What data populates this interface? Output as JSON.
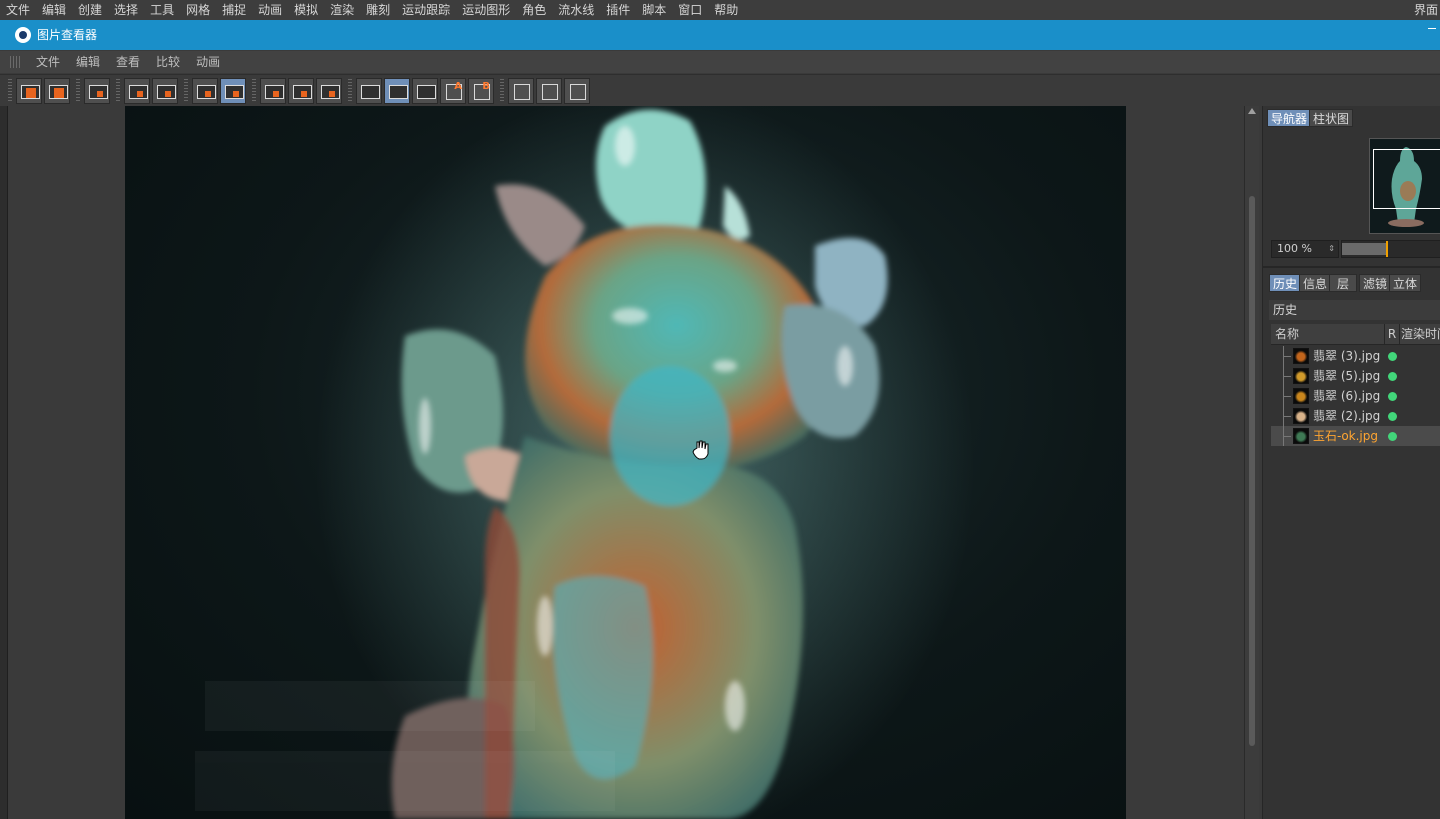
{
  "app_menu": {
    "items": [
      "文件",
      "编辑",
      "创建",
      "选择",
      "工具",
      "网格",
      "捕捉",
      "动画",
      "模拟",
      "渲染",
      "雕刻",
      "运动跟踪",
      "运动图形",
      "角色",
      "流水线",
      "插件",
      "脚本",
      "窗口",
      "帮助"
    ],
    "right_label": "界面"
  },
  "window": {
    "title": "图片查看器",
    "accent_color": "#1a8fc9"
  },
  "viewer_menu": {
    "items": [
      "文件",
      "编辑",
      "查看",
      "比较",
      "动画"
    ]
  },
  "toolbar": {
    "buttons": [
      {
        "icon": "open-file-icon",
        "active": false
      },
      {
        "icon": "save-file-icon",
        "active": false
      },
      {
        "icon": "grid-icon",
        "active": false
      },
      {
        "icon": "render-region-icon",
        "active": false
      },
      {
        "icon": "export-icon",
        "active": false
      },
      {
        "icon": "layers-icon",
        "active": false
      },
      {
        "icon": "copy-icon",
        "active": true
      },
      {
        "icon": "frame-view-icon",
        "active": false
      },
      {
        "icon": "frame-view-alt-icon",
        "active": false
      },
      {
        "icon": "eye-icon",
        "active": false
      },
      {
        "icon": "ab-compare-icon",
        "active": false
      },
      {
        "icon": "ab-split-icon",
        "active": true
      },
      {
        "icon": "ab-swap-icon",
        "active": false
      },
      {
        "icon": "set-a-icon",
        "active": false
      },
      {
        "icon": "set-b-icon",
        "active": false
      },
      {
        "icon": "text-overlay-icon",
        "active": false
      },
      {
        "icon": "split-vertical-icon",
        "active": false
      },
      {
        "icon": "split-horizontal-icon",
        "active": false
      }
    ]
  },
  "right_panel": {
    "top_tabs": [
      {
        "label": "导航器",
        "active": true
      },
      {
        "label": "柱状图",
        "active": false
      }
    ],
    "zoom": {
      "value": "100 %",
      "slider_fraction": 0.45
    },
    "bottom_tabs": [
      {
        "label": "历史",
        "active": true
      },
      {
        "label": "信息",
        "active": false
      },
      {
        "label": "层",
        "active": false
      },
      {
        "label": "滤镜",
        "active": false
      },
      {
        "label": "立体",
        "active": false
      }
    ],
    "history": {
      "title": "历史",
      "columns": {
        "name": "名称",
        "r": "R",
        "render_time": "渲染时间"
      },
      "rows": [
        {
          "name": "翡翠 (3).jpg",
          "thumb_color": "#c2651c",
          "selected": false
        },
        {
          "name": "翡翠 (5).jpg",
          "thumb_color": "#d19a2b",
          "selected": false
        },
        {
          "name": "翡翠 (6).jpg",
          "thumb_color": "#c9861d",
          "selected": false
        },
        {
          "name": "翡翠 (2).jpg",
          "thumb_color": "#d9b38a",
          "selected": false
        },
        {
          "name": "玉石-ok.jpg",
          "thumb_color": "#3f7a55",
          "selected": true
        }
      ],
      "status_color": "#42d67a",
      "selected_text_color": "#ffa531"
    }
  },
  "viewport": {
    "image_subject": "jade-guanyu-statue-render",
    "background_color": "#0d1718"
  }
}
